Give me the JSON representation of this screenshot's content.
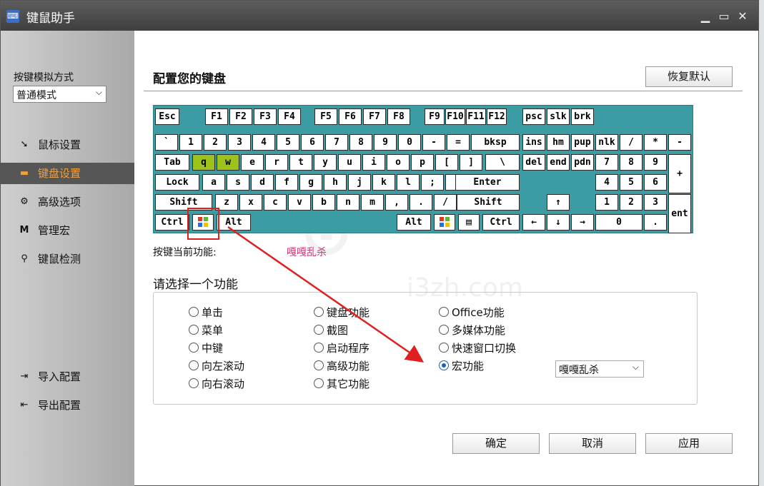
{
  "window": {
    "title": "键鼠助手",
    "app_icon": "keyboard-mouse-app-icon"
  },
  "sidebar": {
    "mode_label": "按键模拟方式",
    "mode_value": "普通模式",
    "items": [
      {
        "label": "鼠标设置",
        "icon": "mouse-icon"
      },
      {
        "label": "键盘设置",
        "icon": "keyboard-icon"
      },
      {
        "label": "高级选项",
        "icon": "gear-icon"
      },
      {
        "label": "管理宏",
        "icon": "macro-icon"
      },
      {
        "label": "键鼠检测",
        "icon": "magnifier-icon"
      }
    ],
    "import_label": "导入配置",
    "export_label": "导出配置"
  },
  "main": {
    "heading": "配置您的键盘",
    "restore_default": "恢复默认",
    "current_function_label": "按键当前功能:",
    "current_function_value": "嘎嘎乱杀",
    "choose_label": "请选择一个功能",
    "options": {
      "col1": [
        "单击",
        "菜单",
        "中键",
        "向左滚动",
        "向右滚动"
      ],
      "col2": [
        "键盘功能",
        "截图",
        "启动程序",
        "高级功能",
        "其它功能"
      ],
      "col3": [
        "Office功能",
        "多媒体功能",
        "快速窗口切换",
        "宏功能"
      ]
    },
    "selected_option": "宏功能",
    "macro_select_value": "嘎嘎乱杀",
    "ok": "确定",
    "cancel": "取消",
    "apply": "应用",
    "watermark": "i3zh.com"
  },
  "keyboard": {
    "row1": [
      "Esc",
      "F1",
      "F2",
      "F3",
      "F4",
      "F5",
      "F6",
      "F7",
      "F8",
      "F9",
      "F10",
      "F11",
      "F12",
      "psc",
      "slk",
      "brk"
    ],
    "row2": [
      "`",
      "1",
      "2",
      "3",
      "4",
      "5",
      "6",
      "7",
      "8",
      "9",
      "0",
      "-",
      "=",
      "bksp",
      "ins",
      "hm",
      "pup",
      "nlk",
      "/",
      "*",
      "-"
    ],
    "row3": [
      "Tab",
      "q",
      "w",
      "e",
      "r",
      "t",
      "y",
      "u",
      "i",
      "o",
      "p",
      "[",
      "]",
      "\\",
      "del",
      "end",
      "pdn",
      "7",
      "8",
      "9",
      "+"
    ],
    "row4": [
      "Lock",
      "a",
      "s",
      "d",
      "f",
      "g",
      "h",
      "j",
      "k",
      "l",
      ";",
      "'",
      "Enter",
      "4",
      "5",
      "6"
    ],
    "row5": [
      "Shift",
      "z",
      "x",
      "c",
      "v",
      "b",
      "n",
      "m",
      ",",
      ".",
      "/",
      "Shift",
      "↑",
      "1",
      "2",
      "3",
      "ent"
    ],
    "row6": [
      "Ctrl",
      "Win",
      "Alt",
      "Alt",
      "Win",
      "Menu",
      "Ctrl",
      "←",
      "↓",
      "→",
      "0",
      "."
    ],
    "highlighted": [
      "q",
      "w"
    ],
    "selected_key": "Win"
  },
  "colors": {
    "keyboard_bg": "#3b9ca3",
    "highlight": "#9cc21c",
    "active_nav": "#f0a040",
    "annotation": "#e02020",
    "func_value": "#d0307a"
  }
}
